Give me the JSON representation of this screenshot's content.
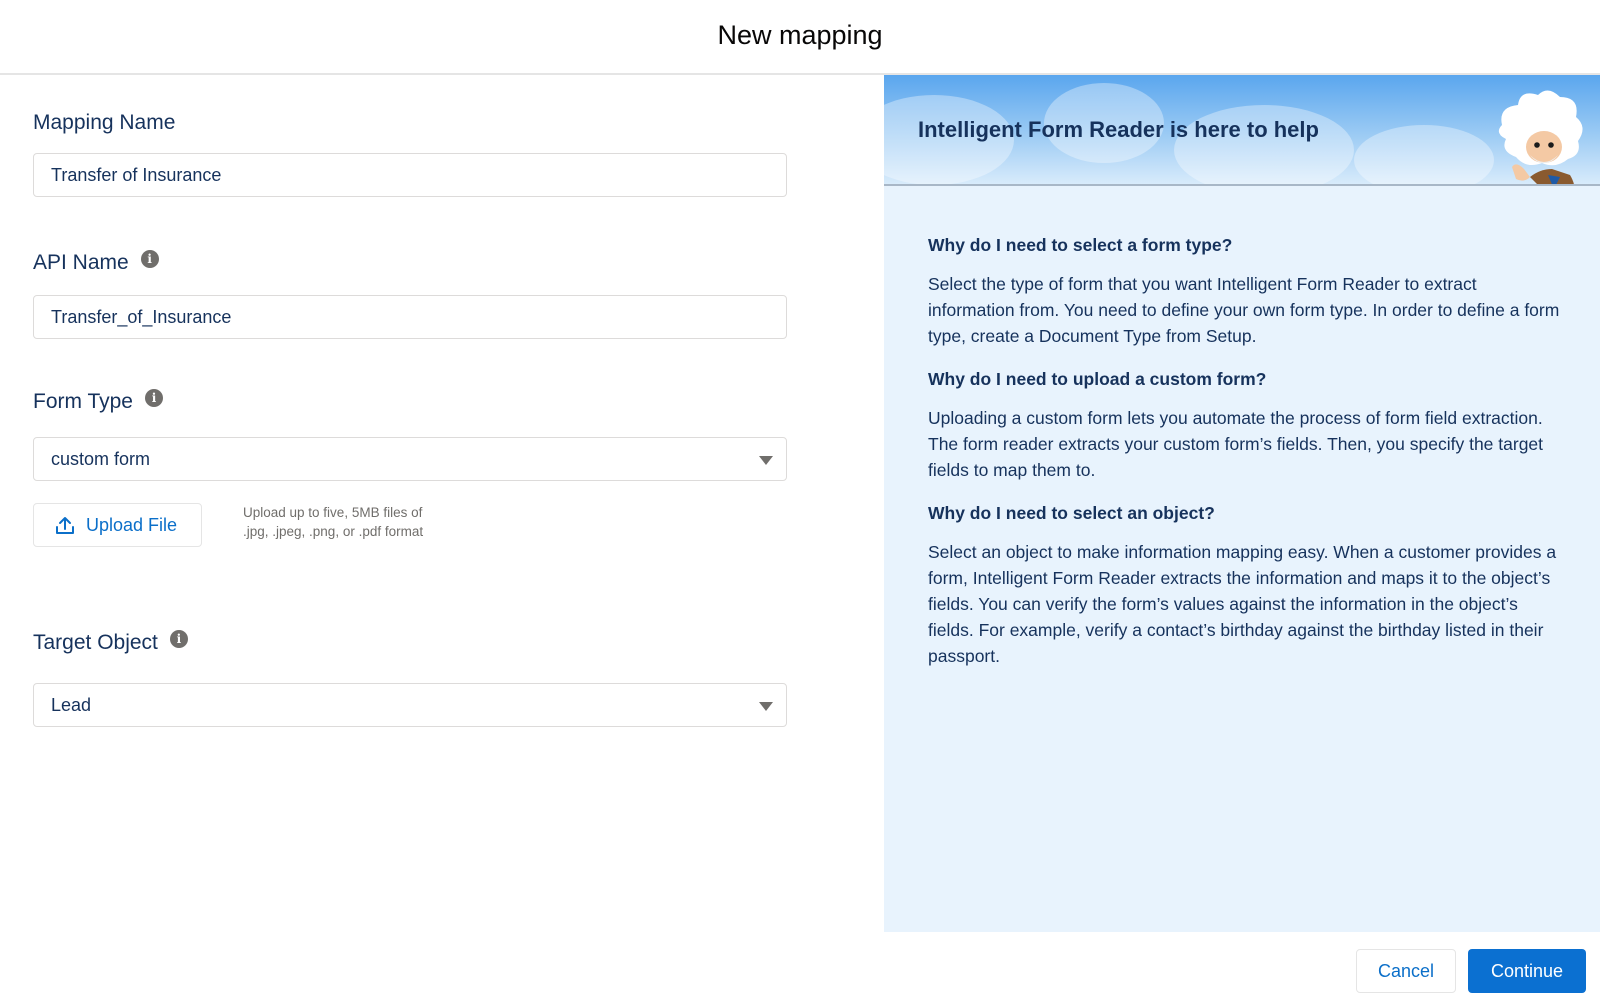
{
  "header": {
    "title": "New mapping"
  },
  "form": {
    "mapping_name": {
      "label": "Mapping Name",
      "value": "Transfer of Insurance"
    },
    "api_name": {
      "label": "API Name",
      "value": "Transfer_of_Insurance",
      "info_icon": "info-icon"
    },
    "form_type": {
      "label": "Form Type",
      "value": "custom form",
      "info_icon": "info-icon"
    },
    "upload": {
      "button_label": "Upload File",
      "help_line1": "Upload up to five, 5MB files of",
      "help_line2": ".jpg, .jpeg, .png, or .pdf format"
    },
    "target_object": {
      "label": "Target Object",
      "value": "Lead",
      "info_icon": "info-icon"
    }
  },
  "help_panel": {
    "title": "Intelligent Form Reader is here to help",
    "sections": [
      {
        "heading": "Why do I need to select a form type?",
        "body": "Select the type of form that you want Intelligent Form Reader to extract information from. You need to define your own form type. In order to define a form type, create a Document Type from Setup."
      },
      {
        "heading": "Why do I need to upload a custom form?",
        "body": "Uploading a custom form lets you automate the process of form field extraction. The form reader extracts your custom form’s fields. Then, you specify the target fields to map them to."
      },
      {
        "heading": "Why do I need to select an object?",
        "body": "Select an object to make information mapping easy. When a customer provides a form, Intelligent Form Reader extracts the information and maps it to the object’s fields. You can verify the form’s values against the information in the object’s fields. For example, verify a contact’s birthday against the birthday listed in their passport."
      }
    ]
  },
  "footer": {
    "cancel_label": "Cancel",
    "continue_label": "Continue"
  },
  "colors": {
    "brand": "#0b70d1",
    "text": "#16325c",
    "panel_bg": "#e8f3fd"
  }
}
